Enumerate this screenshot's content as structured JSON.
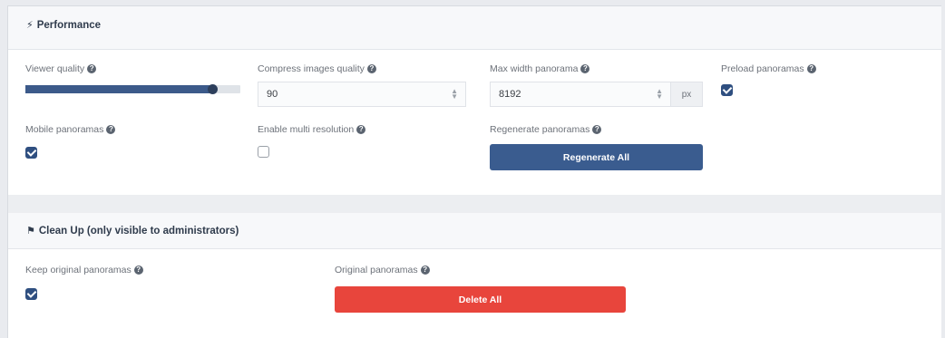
{
  "performance": {
    "title": "Performance",
    "viewer_quality": {
      "label": "Viewer quality",
      "value_fraction": 0.87
    },
    "compress_quality": {
      "label": "Compress images quality",
      "value": "90"
    },
    "max_width": {
      "label": "Max width panorama",
      "value": "8192",
      "unit": "px"
    },
    "preload": {
      "label": "Preload panoramas",
      "checked": true
    },
    "mobile": {
      "label": "Mobile panoramas",
      "checked": true
    },
    "multi_res": {
      "label": "Enable multi resolution",
      "checked": false
    },
    "regenerate": {
      "label": "Regenerate panoramas",
      "button": "Regenerate All"
    }
  },
  "cleanup": {
    "title": "Clean Up (only visible to administrators)",
    "keep_original": {
      "label": "Keep original panoramas",
      "checked": true
    },
    "original": {
      "label": "Original panoramas",
      "button": "Delete All"
    }
  },
  "colors": {
    "accent": "#3a5c8f",
    "danger": "#e8453c",
    "checkbox": "#2f4f80"
  },
  "icons": {
    "performance": "bolt-icon",
    "cleanup": "broom-icon",
    "help": "question-circle-icon"
  }
}
